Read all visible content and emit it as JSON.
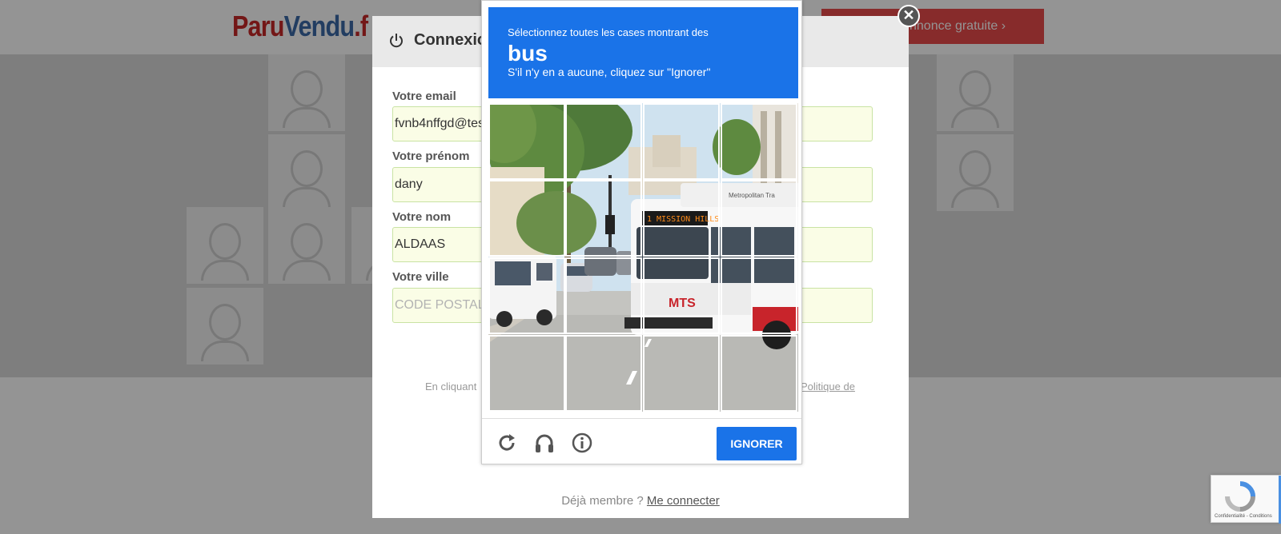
{
  "site": {
    "logo_part1": "Paru",
    "logo_part2": "Vendu",
    "logo_part3": ".f",
    "post_ad_label": "nnonce gratuite"
  },
  "modal": {
    "title": "Connexio",
    "email_label": "Votre email",
    "email_value": "fvnb4nffgd@tes",
    "firstname_label": "Votre prénom",
    "firstname_value": "dany",
    "lastname_label": "Votre nom",
    "lastname_value": "ALDAAS",
    "city_label": "Votre ville",
    "city_placeholder": "CODE POSTAL",
    "legal_text": "En cliquant",
    "legal_link": "Politique de",
    "already_member_text": "Déjà membre ?",
    "login_link": "Me connecter"
  },
  "captcha": {
    "instruction_line1": "Sélectionnez toutes les cases montrant des",
    "keyword": "bus",
    "instruction_line2": "S'il n'y en a aucune, cliquez sur \"Ignorer\"",
    "bus_destination": "1 MISSION HILLS",
    "bus_logo": "MTS",
    "bus_operator": "Metropolitan Tra",
    "skip_label": "IGNORER",
    "icons": [
      "reload-icon",
      "audio-icon",
      "info-icon"
    ]
  },
  "badge": {
    "text": "Confidentialité - Conditions"
  },
  "colors": {
    "accent": "#1a73e8",
    "field_bg": "#fafde6",
    "field_border": "#c9e3a3",
    "brand_red": "#c62828"
  }
}
